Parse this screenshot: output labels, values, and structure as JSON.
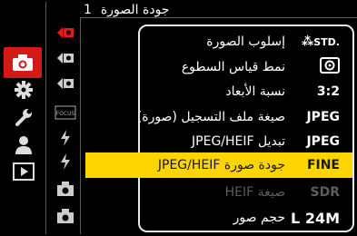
{
  "header": {
    "page_number": "1",
    "title": "جودة الصورة"
  },
  "sidebar": {
    "items": [
      {
        "icon": "camera-icon",
        "active": true
      },
      {
        "icon": "gear-icon"
      },
      {
        "icon": "wrench-icon"
      },
      {
        "icon": "person-icon"
      },
      {
        "icon": "playback-icon"
      }
    ]
  },
  "subcol": {
    "items": [
      {
        "icon": "photo-mode-icon-1",
        "active": true
      },
      {
        "icon": "photo-mode-icon-2"
      },
      {
        "icon": "photo-mode-icon-3"
      },
      {
        "icon": "focus-icon",
        "text": "FOCUS"
      },
      {
        "icon": "flash-icon-1"
      },
      {
        "icon": "flash-icon-2"
      },
      {
        "icon": "camera-mode-icon-1"
      },
      {
        "icon": "camera-mode-icon-2"
      }
    ]
  },
  "menu": {
    "rows": [
      {
        "label": "إسلوب الصورة",
        "value": "STD."
      },
      {
        "label": "نمط قياس السطوع",
        "value": "(◉)"
      },
      {
        "label": "نسبة الأبعاد",
        "value": "3:2"
      },
      {
        "label": "صيغة ملف التسجيل (صورة)",
        "value": "JPEG"
      },
      {
        "label": "تبديل JPEG/HEIF",
        "value": "JPEG"
      },
      {
        "label": "جودة صورة JPEG/HEIF",
        "value": "FINE",
        "selected": true
      },
      {
        "label": "صيغة HEIF",
        "value": "SDR",
        "disabled": true
      },
      {
        "label": "حجم صور",
        "value": "L 24M"
      }
    ]
  },
  "colors": {
    "accent": "#d21a1a",
    "highlight": "#ffd500"
  }
}
